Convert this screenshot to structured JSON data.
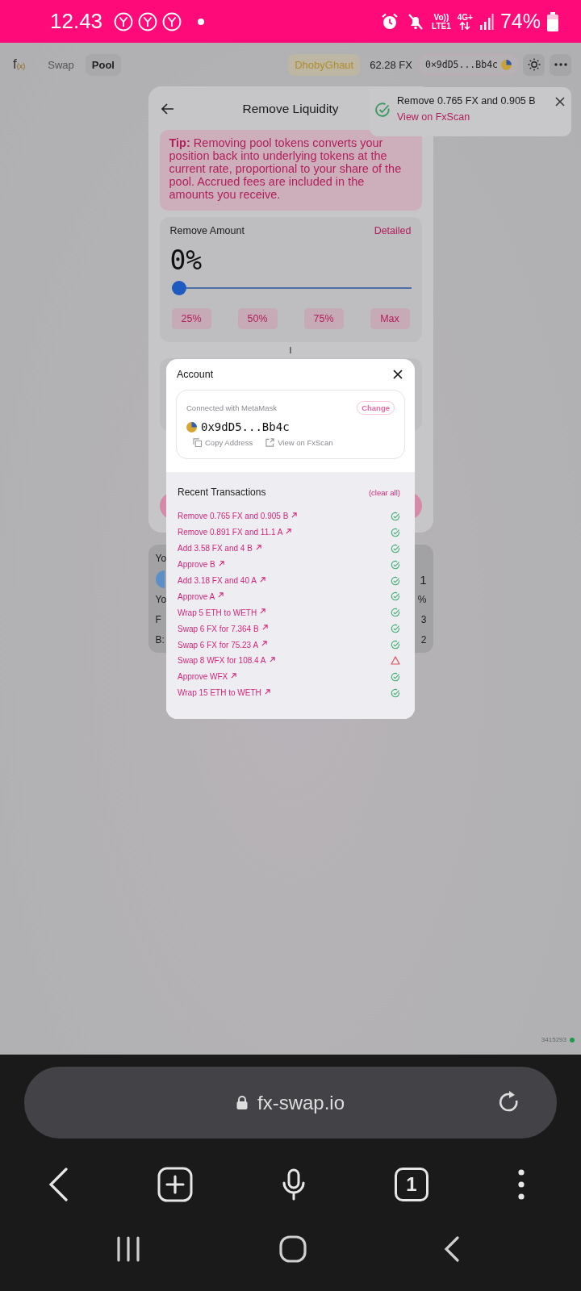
{
  "status_bar": {
    "time": "12.43",
    "network_labels": [
      "Vo))",
      "LTE1",
      "4G+"
    ],
    "battery": "74%"
  },
  "header": {
    "logo": "f",
    "logo_sub": "(x)",
    "nav": [
      {
        "label": "Swap",
        "selected": false
      },
      {
        "label": "Pool",
        "selected": true
      }
    ],
    "network": "DhobyGhaut",
    "balance": "62.28 FX",
    "address": "0×9dD5...Bb4c"
  },
  "remove_liquidity": {
    "title": "Remove Liquidity",
    "tip": "**Tip:** Removing pool tokens converts your position back into underlying tokens at the current rate, proportional to your share of the pool. Accrued fees are included in the amounts you receive.",
    "amount_label": "Remove Amount",
    "mode_link": "Detailed",
    "percent": "0%",
    "slider": {
      "level": 0
    },
    "presets": [
      "25%",
      "50%",
      "75%",
      "Max"
    ]
  },
  "toast": {
    "message": "Remove 0.765 FX and 0.905 B",
    "link": "View on FxScan"
  },
  "position_card": {
    "rows": [
      {
        "label": "Yo"
      },
      {
        "token_icon": true,
        "value": "1"
      },
      {
        "label": "Yo",
        "value": "%"
      },
      {
        "label": "F",
        "value": "3"
      },
      {
        "label": "B:",
        "value": "2"
      }
    ]
  },
  "account_modal": {
    "title": "Account",
    "connected_label": "Connected with MetaMask",
    "change": "Change",
    "address": "0x9dD5...Bb4c",
    "actions": [
      {
        "kind": "copy",
        "label": "Copy Address"
      },
      {
        "kind": "external",
        "label": "View on FxScan"
      }
    ],
    "transactions_title": "Recent Transactions",
    "clear": "(clear all)",
    "transactions": [
      {
        "label": "Remove 0.765 FX and 0.905 B",
        "kind": "success"
      },
      {
        "label": "Remove 0.891 FX and 11.1 A",
        "kind": "success"
      },
      {
        "label": "Add 3.58 FX and 4 B",
        "kind": "success"
      },
      {
        "label": "Approve B",
        "kind": "success"
      },
      {
        "label": "Add 3.18 FX and 40 A",
        "kind": "success"
      },
      {
        "label": "Approve A",
        "kind": "success"
      },
      {
        "label": "Wrap 5 ETH to WETH",
        "kind": "success"
      },
      {
        "label": "Swap 6 FX for 7.364 B",
        "kind": "success"
      },
      {
        "label": "Swap 6 FX for 75.23 A",
        "kind": "success"
      },
      {
        "label": "Swap 8 WFX for 108.4 A",
        "kind": "failed"
      },
      {
        "label": "Approve WFX",
        "kind": "success"
      },
      {
        "label": "Wrap 15 ETH to WETH",
        "kind": "success"
      }
    ]
  },
  "block_number": "3415293",
  "browser": {
    "url": "fx-swap.io",
    "tab_count": "1"
  }
}
